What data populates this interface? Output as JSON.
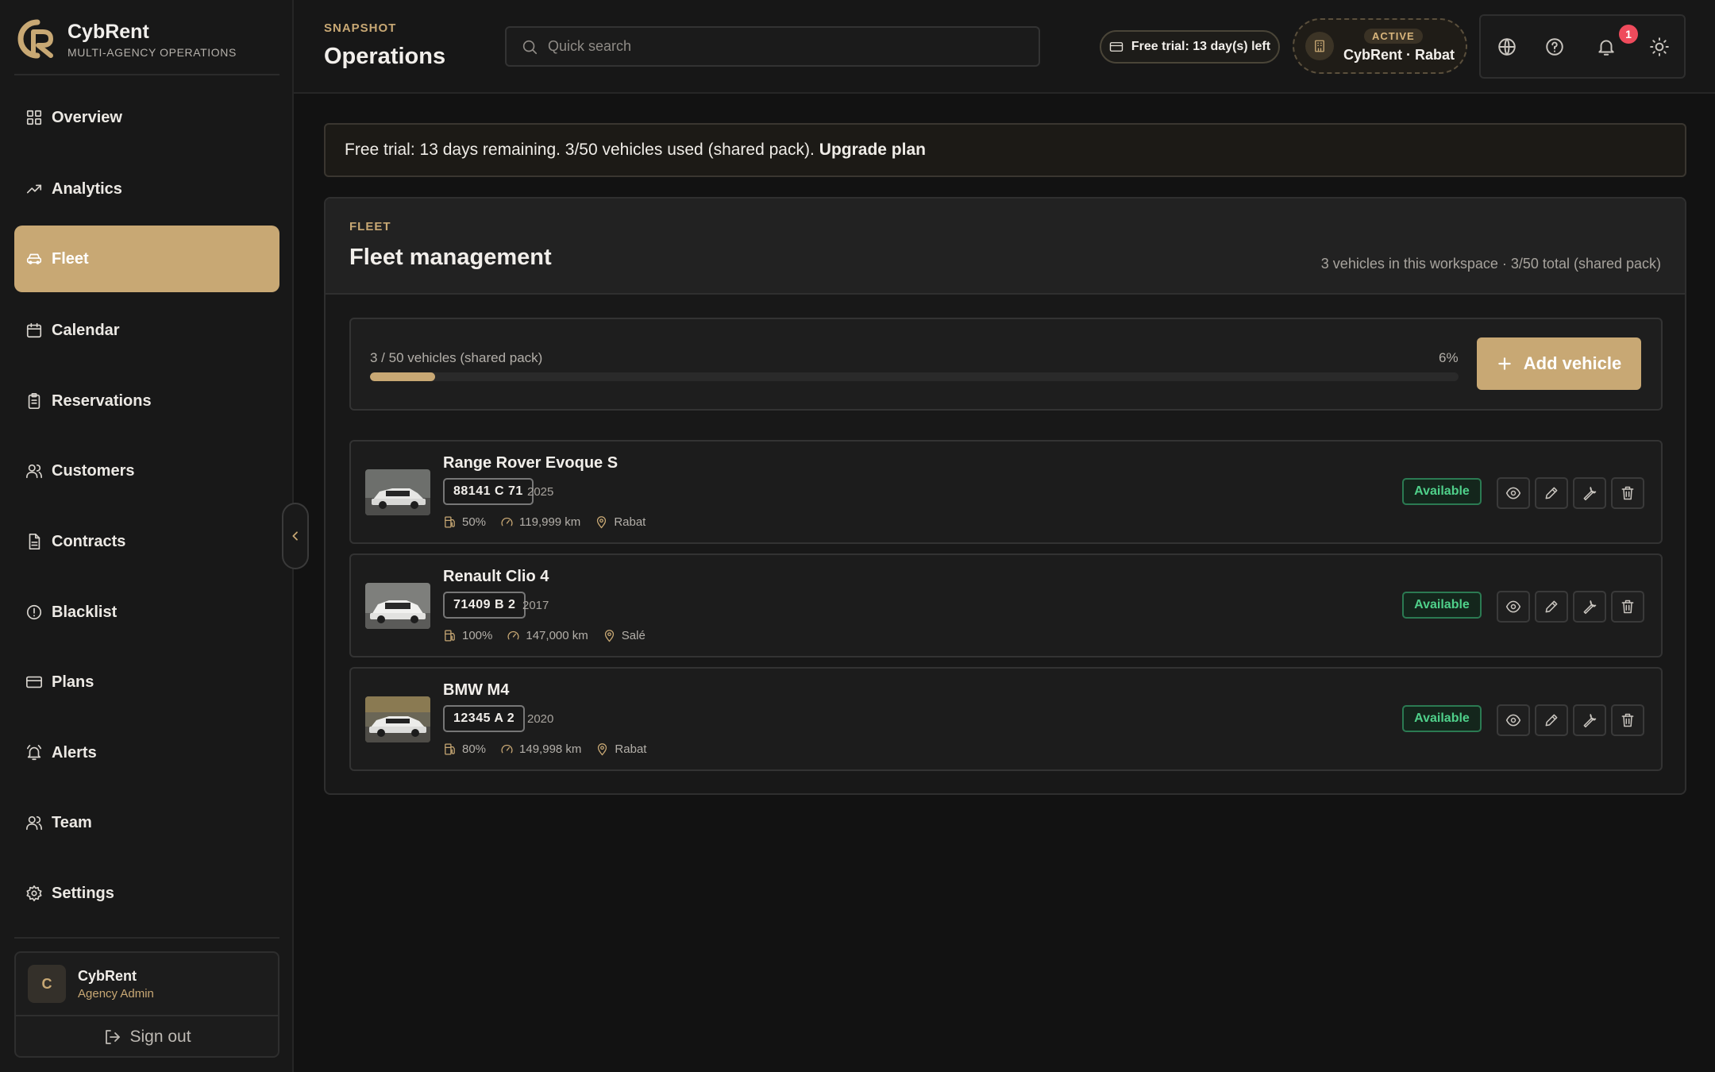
{
  "brand": {
    "name": "CybRent",
    "tagline": "MULTI-AGENCY OPERATIONS"
  },
  "sidebar": {
    "items": [
      {
        "label": "Overview",
        "icon": "grid-icon"
      },
      {
        "label": "Analytics",
        "icon": "trending-up-icon"
      },
      {
        "label": "Fleet",
        "icon": "car-icon",
        "active": true
      },
      {
        "label": "Calendar",
        "icon": "calendar-icon"
      },
      {
        "label": "Reservations",
        "icon": "clipboard-icon"
      },
      {
        "label": "Customers",
        "icon": "users-icon"
      },
      {
        "label": "Contracts",
        "icon": "document-icon"
      },
      {
        "label": "Blacklist",
        "icon": "alert-circle-icon"
      },
      {
        "label": "Plans",
        "icon": "credit-card-icon"
      },
      {
        "label": "Alerts",
        "icon": "bell-ring-icon"
      },
      {
        "label": "Team",
        "icon": "users-icon"
      },
      {
        "label": "Settings",
        "icon": "gear-icon"
      }
    ],
    "user": {
      "initial": "C",
      "name": "CybRent",
      "role": "Agency Admin",
      "sign_out": "Sign out"
    }
  },
  "header": {
    "eyebrow": "SNAPSHOT",
    "title": "Operations",
    "search_placeholder": "Quick search",
    "trial_pill": "Free trial: 13 day(s) left",
    "agency_status": "ACTIVE",
    "agency_name": "CybRent · Rabat",
    "notification_count": "1"
  },
  "banner": {
    "text": "Free trial: 13 days remaining. 3/50 vehicles used (shared pack).",
    "link": "Upgrade plan"
  },
  "fleet": {
    "eyebrow": "FLEET",
    "title": "Fleet management",
    "summary": "3 vehicles in this workspace · 3/50 total (shared pack)",
    "usage_label": "3 / 50 vehicles (shared pack)",
    "usage_percent_label": "6%",
    "usage_fraction": 0.06,
    "add_button": "Add vehicle",
    "vehicles": [
      {
        "name": "Range Rover Evoque S",
        "plate": "88141 C 71",
        "year": "2025",
        "fuel": "50%",
        "mileage": "119,999 km",
        "location": "Rabat",
        "status": "Available"
      },
      {
        "name": "Renault Clio 4",
        "plate": "71409 B 2",
        "year": "2017",
        "fuel": "100%",
        "mileage": "147,000 km",
        "location": "Salé",
        "status": "Available"
      },
      {
        "name": "BMW M4",
        "plate": "12345 A 2",
        "year": "2020",
        "fuel": "80%",
        "mileage": "149,998 km",
        "location": "Rabat",
        "status": "Available"
      }
    ]
  },
  "colors": {
    "accent": "#c8a874",
    "status_available": "#4fd08a",
    "notification": "#ef4b5c"
  }
}
